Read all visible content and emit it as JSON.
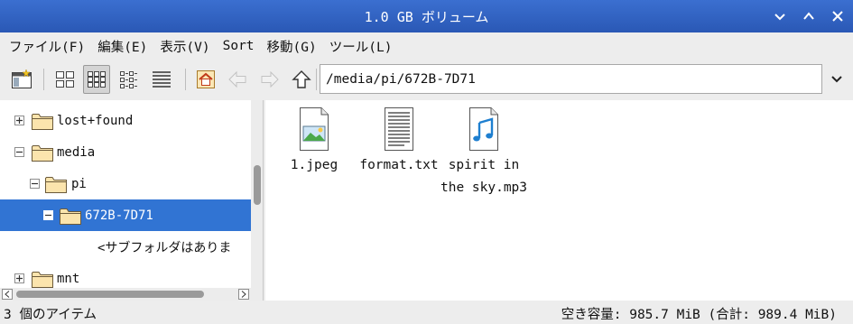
{
  "window": {
    "title": "1.0 GB ボリューム"
  },
  "menu": {
    "items": [
      "ファイル(F)",
      "編集(E)",
      "表示(V)",
      "Sort",
      "移動(G)",
      "ツール(L)"
    ]
  },
  "toolbar": {
    "buttons": [
      "new-window-icon",
      "icon-view-icon",
      "thumbnail-view-icon",
      "compact-view-icon",
      "detail-list-icon",
      "home-icon",
      "back-arrow-icon",
      "forward-arrow-icon",
      "up-arrow-icon"
    ],
    "active_view": "thumbnail-view-icon"
  },
  "address": {
    "path": "/media/pi/672B-7D71"
  },
  "tree": {
    "items": [
      {
        "label": "lost+found",
        "expander": "+"
      },
      {
        "label": "media",
        "expander": "−"
      },
      {
        "label": "pi",
        "expander": "−"
      },
      {
        "label": "672B-7D71",
        "expander": "−",
        "selected": true
      },
      {
        "label": "<サブフォルダはありま",
        "placeholder": true
      },
      {
        "label": "mnt",
        "expander": "+"
      }
    ]
  },
  "files": [
    {
      "name_line1": "1.jpeg",
      "name_line2": "",
      "icon": "image-file-icon"
    },
    {
      "name_line1": "format.txt",
      "name_line2": "",
      "icon": "text-file-icon"
    },
    {
      "name_line1": "spirit in",
      "name_line2": "the sky.mp3",
      "icon": "audio-file-icon"
    }
  ],
  "status": {
    "left": "3 個のアイテム",
    "right": "空き容量: 985.7 MiB (合計: 989.4 MiB)"
  },
  "colors": {
    "titlebar": "#2f62c4",
    "selection": "#3174d3"
  }
}
